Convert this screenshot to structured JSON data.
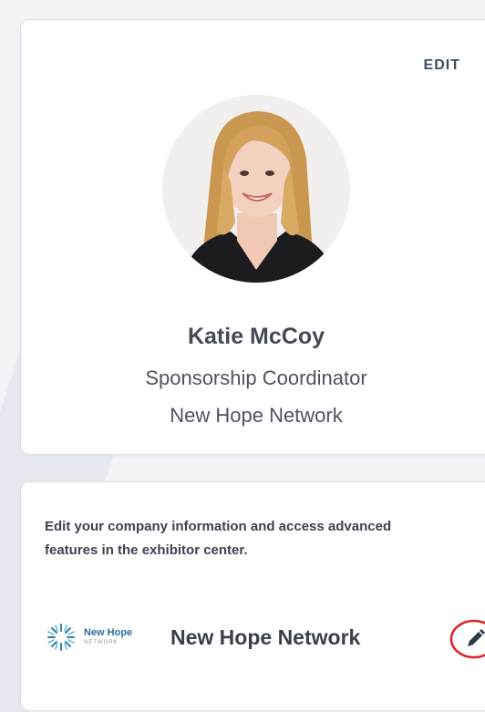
{
  "profile": {
    "edit_label": "EDIT",
    "name": "Katie McCoy",
    "title": "Sponsorship Coordinator",
    "company": "New Hope Network",
    "avatar_icon": "person-photo"
  },
  "company_card": {
    "description": "Edit your company information and access advanced features in the exhibitor center.",
    "logo_text": "New Hope",
    "logo_subtext": "NETWORK",
    "company_name": "New Hope Network",
    "edit_icon": "pencil-icon",
    "highlight_color": "#e02020"
  }
}
